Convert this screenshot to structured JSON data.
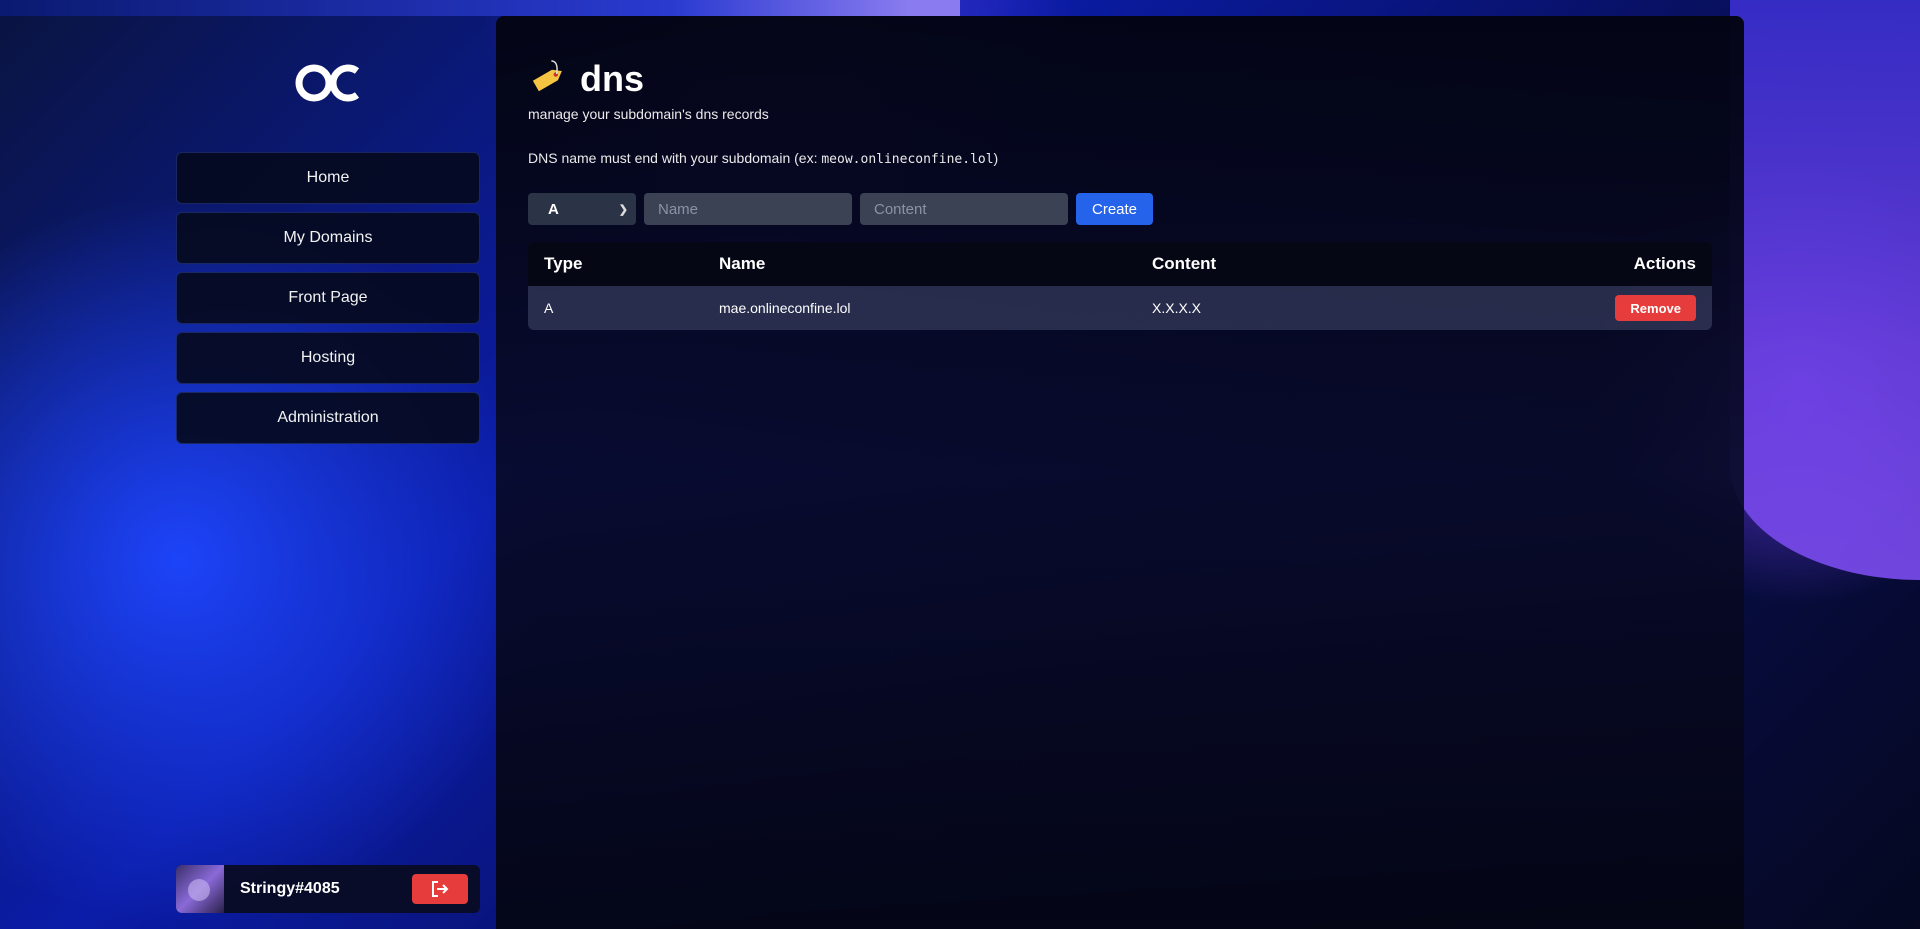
{
  "app": {
    "logo_text": "OC"
  },
  "sidebar": {
    "items": [
      {
        "label": "Home"
      },
      {
        "label": "My Domains"
      },
      {
        "label": "Front Page"
      },
      {
        "label": "Hosting"
      },
      {
        "label": "Administration"
      }
    ],
    "user": {
      "name": "Stringy#4085"
    }
  },
  "page": {
    "title": "dns",
    "subtitle": "manage your subdomain's dns records",
    "notice_prefix": "DNS name must end with your subdomain (ex: ",
    "notice_code": "meow.onlineconfine.lol",
    "notice_suffix": ")"
  },
  "form": {
    "type_value": "A",
    "name_placeholder": "Name",
    "content_placeholder": "Content",
    "create_label": "Create"
  },
  "table": {
    "headers": {
      "type": "Type",
      "name": "Name",
      "content": "Content",
      "actions": "Actions"
    },
    "rows": [
      {
        "type": "A",
        "name": "mae.onlineconfine.lol",
        "content": "X.X.X.X",
        "action_label": "Remove"
      }
    ]
  },
  "colors": {
    "accent": "#2563eb",
    "danger": "#e63c3c"
  }
}
